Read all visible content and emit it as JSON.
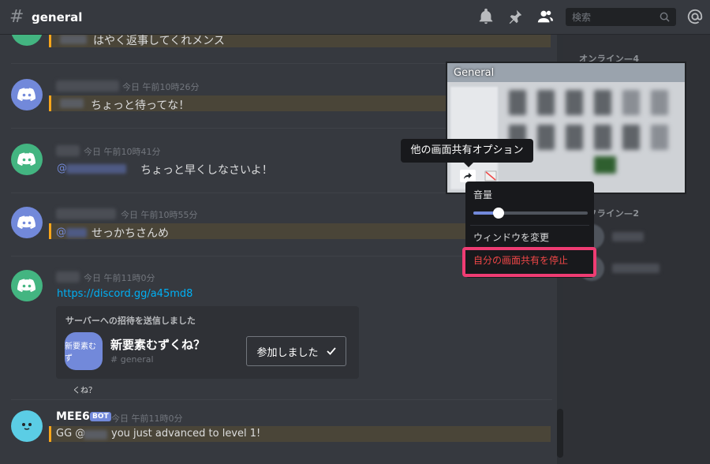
{
  "header": {
    "channel": "general",
    "search_placeholder": "検索"
  },
  "messages": [
    {
      "timestamp": "",
      "text": "はやく返事してくれメンス"
    },
    {
      "timestamp": "今日 午前10時26分",
      "text": "ちょっと待ってな！"
    },
    {
      "timestamp": "今日 午前10時41分",
      "mention": "@",
      "text": "ちょっと早くしなさいよ！"
    },
    {
      "timestamp": "今日 午前10時55分",
      "mention": "@",
      "text": "せっかちさんめ"
    },
    {
      "timestamp": "今日 午前11時0分",
      "link": "https://discord.gg/a45md8"
    },
    {
      "author": "MEE6",
      "bot_tag": "BOT",
      "timestamp": "今日 午前11時0分",
      "prefix": "GG @",
      "text": "you just advanced to level 1!"
    }
  ],
  "invite": {
    "heading": "サーバーへの招待を送信しました",
    "icon_text": "新要素むず",
    "server_name": "新要素むずくね？",
    "channel": "general",
    "button_label": "参加しました",
    "caption": "くね？"
  },
  "stream": {
    "title": "General",
    "tooltip": "他の画面共有オプション"
  },
  "context_menu": {
    "volume_label": "音量",
    "volume_level": 0.22,
    "item_change_window": "ウィンドウを変更",
    "item_stop_share": "自分の画面共有を停止"
  },
  "members": {
    "online_header": "オンライン—4",
    "offline_header": "オフライン—2"
  },
  "colors": {
    "accent": "#7289da",
    "highlight_border": "#faa61a",
    "danger": "#f04747",
    "annotation": "#ef3c73"
  }
}
